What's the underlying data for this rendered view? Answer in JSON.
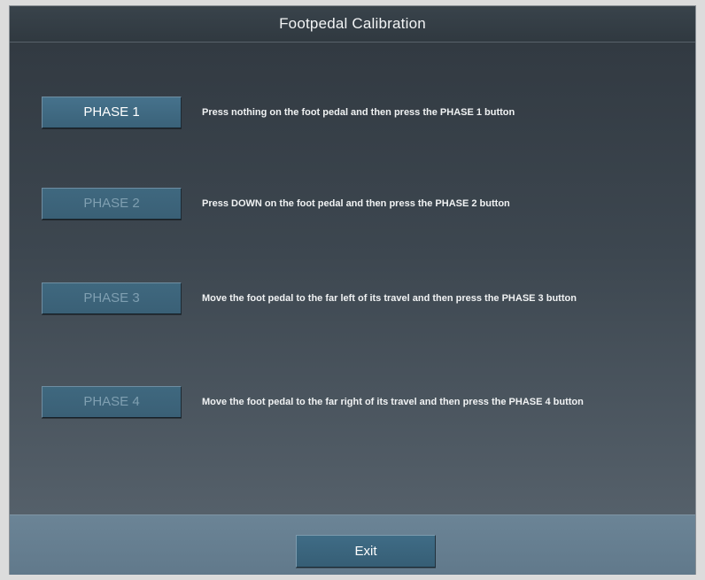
{
  "window": {
    "title": "Footpedal Calibration"
  },
  "phases": [
    {
      "label": "PHASE 1",
      "instruction": "Press nothing on the foot pedal and then press the PHASE 1 button",
      "enabled": true
    },
    {
      "label": "PHASE 2",
      "instruction": "Press DOWN on the foot pedal and then press the PHASE 2 button",
      "enabled": false
    },
    {
      "label": "PHASE 3",
      "instruction": "Move the foot pedal to the far left of its travel and then press the PHASE 3 button",
      "enabled": false
    },
    {
      "label": "PHASE 4",
      "instruction": "Move the foot pedal to the far right of its travel and then press the PHASE 4 button",
      "enabled": false
    }
  ],
  "footer": {
    "exit_label": "Exit"
  },
  "colors": {
    "button_face": "#3f6c86",
    "enabled_text": "#ffffff",
    "disabled_text": "#7f9fb1",
    "title_bar": "#343e46",
    "footer_bg": "#667f91"
  }
}
